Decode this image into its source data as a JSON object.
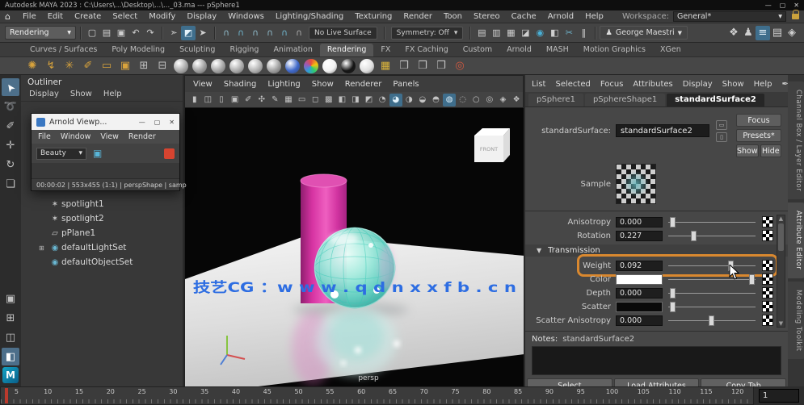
{
  "window": {
    "title": "Autodesk MAYA 2023 : C:\\Users\\...\\Desktop\\...\\..._03.ma  ---  pSphere1",
    "controls": {
      "min": "—",
      "max": "▢",
      "close": "✕"
    }
  },
  "menubar": {
    "home_icon": "⌂",
    "items": [
      "File",
      "Edit",
      "Create",
      "Select",
      "Modify",
      "Display",
      "Windows",
      "Lighting/Shading",
      "Texturing",
      "Render",
      "Toon",
      "Stereo",
      "Cache",
      "Arnold",
      "Help"
    ],
    "workspace_label": "Workspace:",
    "workspace_value": "General*"
  },
  "statusline": {
    "menuset": "Rendering",
    "file_tools": [
      {
        "name": "new-scene-icon",
        "glyph": "▢"
      },
      {
        "name": "open-scene-icon",
        "glyph": "▤"
      },
      {
        "name": "save-scene-icon",
        "glyph": "▣"
      },
      {
        "name": "undo-icon",
        "glyph": "↶"
      },
      {
        "name": "redo-icon",
        "glyph": "↷"
      }
    ],
    "selection_tools": [
      {
        "name": "select-hierarchy-icon",
        "glyph": "➣"
      },
      {
        "name": "select-object-icon",
        "glyph": "◩",
        "active": true
      },
      {
        "name": "select-component-icon",
        "glyph": "➤"
      }
    ],
    "snap_tools": [
      {
        "name": "snap-grid-icon",
        "glyph": "∩",
        "color": "#8fb9c9"
      },
      {
        "name": "snap-curve-icon",
        "glyph": "∩",
        "color": "#6fb4cc"
      },
      {
        "name": "snap-point-icon",
        "glyph": "∩",
        "color": "#8fb9c9"
      },
      {
        "name": "snap-projected-icon",
        "glyph": "∩",
        "color": "#8fb9c9"
      },
      {
        "name": "snap-view-icon",
        "glyph": "∩",
        "color": "#6fb4cc"
      },
      {
        "name": "snap-surface-icon",
        "glyph": "∩",
        "color": "#a9a9a9"
      }
    ],
    "live_surface_label": "No Live Surface",
    "symmetry_label": "Symmetry: Off",
    "render_tools": [
      {
        "name": "render-frame-icon",
        "glyph": "▤"
      },
      {
        "name": "ipr-render-icon",
        "glyph": "▥"
      },
      {
        "name": "render-sequence-icon",
        "glyph": "▦"
      },
      {
        "name": "render-settings-icon",
        "glyph": "◪"
      },
      {
        "name": "arnold-renderview-icon",
        "glyph": "◉",
        "color": "#49b0d6"
      },
      {
        "name": "texture-view-icon",
        "glyph": "◧"
      },
      {
        "name": "cut-icon",
        "glyph": "✂",
        "color": "#6fb4cc"
      },
      {
        "name": "pause-icon",
        "glyph": "‖"
      }
    ],
    "user": {
      "icon": "♟",
      "label": "George Maestri",
      "caret": "▼"
    },
    "panel_toggles": [
      {
        "name": "modeling-toolkit-icon",
        "glyph": "❖"
      },
      {
        "name": "character-controls-icon",
        "glyph": "♟"
      },
      {
        "name": "channel-box-icon",
        "glyph": "≡",
        "active": true
      },
      {
        "name": "attribute-editor-icon",
        "glyph": "▤"
      },
      {
        "name": "tool-settings-icon",
        "glyph": "◈"
      }
    ]
  },
  "shelf": {
    "corner_icon": "☰",
    "tabs": [
      {
        "label": "Curves / Surfaces"
      },
      {
        "label": "Poly Modeling"
      },
      {
        "label": "Sculpting"
      },
      {
        "label": "Rigging"
      },
      {
        "label": "Animation"
      },
      {
        "label": "Rendering",
        "active": true
      },
      {
        "label": "FX"
      },
      {
        "label": "FX Caching"
      },
      {
        "label": "Custom"
      },
      {
        "label": "Arnold"
      },
      {
        "label": "MASH"
      },
      {
        "label": "Motion Graphics"
      },
      {
        "label": "XGen"
      }
    ],
    "icons": [
      {
        "name": "area-light-icon",
        "glyph": "✺",
        "color": "#d8a33c"
      },
      {
        "name": "directional-light-icon",
        "glyph": "↯",
        "color": "#d8a33c"
      },
      {
        "name": "point-light-icon",
        "glyph": "✳",
        "color": "#d8a33c"
      },
      {
        "name": "spot-light-icon",
        "glyph": "✐",
        "color": "#d8a33c"
      },
      {
        "name": "volume-light-icon",
        "glyph": "▭",
        "color": "#d8a33c"
      },
      {
        "name": "ambient-light-icon",
        "glyph": "▣",
        "color": "#d8a33c"
      },
      {
        "name": "shading-group-icon",
        "glyph": "⊞",
        "color": "#c2c2c2"
      },
      {
        "name": "hypershade-icon",
        "glyph": "⊟",
        "color": "#c2c2c2"
      },
      {
        "name": "lambert-material-icon",
        "shape": "ball",
        "color": "#a9a9a9"
      },
      {
        "name": "blinn-material-icon",
        "shape": "ball",
        "color": "#9f9f9f"
      },
      {
        "name": "phong-material-icon",
        "shape": "ball",
        "color": "#a5a5a5"
      },
      {
        "name": "standard-surface-icon",
        "shape": "ball",
        "color": "#ababab"
      },
      {
        "name": "ai-standard-surface-icon",
        "shape": "ball",
        "color": "#b2b2b2"
      },
      {
        "name": "layered-shader-icon",
        "shape": "ball",
        "color": "#a0a0a0"
      },
      {
        "name": "car-paint-shader-icon",
        "shape": "ball",
        "color": "#3f68c9"
      },
      {
        "name": "toon-shader-icon",
        "shape": "ball",
        "color": "rainbow"
      },
      {
        "name": "surface-shader-white-icon",
        "shape": "ball",
        "color": "#f2f2f2"
      },
      {
        "name": "surface-shader-black-icon",
        "shape": "ball",
        "color": "#141414"
      },
      {
        "name": "use-background-icon",
        "shape": "ball",
        "color": "#e0e0e0"
      },
      {
        "name": "checker-texture-icon",
        "glyph": "▦",
        "color": "#d8b23c"
      },
      {
        "name": "assign-material-icon",
        "glyph": "❒",
        "color": "#c2c2c2"
      },
      {
        "name": "bake-texture-icon",
        "glyph": "❒",
        "color": "#c2c2c2"
      },
      {
        "name": "light-editor-icon",
        "glyph": "❒",
        "color": "#c2c2c2"
      },
      {
        "name": "render-target-icon",
        "glyph": "◎",
        "color": "#cf5840"
      }
    ]
  },
  "toolbox": {
    "tools": [
      {
        "name": "select-tool",
        "glyph": "➤",
        "active": true
      },
      {
        "name": "lasso-tool",
        "glyph": "➰"
      },
      {
        "name": "paint-select-tool",
        "glyph": "✐"
      },
      {
        "name": "move-tool",
        "glyph": "✛"
      },
      {
        "name": "rotate-tool",
        "glyph": "↻"
      },
      {
        "name": "scale-tool",
        "glyph": "❏"
      }
    ],
    "layouts": [
      {
        "name": "layout-single-pane",
        "glyph": "▣"
      },
      {
        "name": "layout-four-pane",
        "glyph": "⊞"
      },
      {
        "name": "layout-two-pane",
        "glyph": "◫"
      },
      {
        "name": "layout-outliner-persp",
        "glyph": "◧",
        "active": true
      }
    ],
    "maya_logo": "M"
  },
  "outliner": {
    "title": "Outliner",
    "menus": [
      "Display",
      "Show",
      "Help"
    ],
    "items": [
      {
        "label": "spotlight1",
        "icon": "✶",
        "icon_color": "#cccccc"
      },
      {
        "label": "spotlight2",
        "icon": "✶",
        "icon_color": "#cccccc"
      },
      {
        "label": "pPlane1",
        "icon": "▱",
        "icon_color": "#cccccc"
      },
      {
        "label": "defaultLightSet",
        "icon": "◉",
        "icon_color": "#69b7d2",
        "expand": true
      },
      {
        "label": "defaultObjectSet",
        "icon": "◉",
        "icon_color": "#69b7d2"
      }
    ]
  },
  "arnold_window": {
    "title": "Arnold Viewp...",
    "controls": {
      "min": "—",
      "max": "▢",
      "close": "✕"
    },
    "menus": [
      "File",
      "Window",
      "View",
      "Render"
    ],
    "aov_value": "Beauty",
    "status": "00:00:02 | 553x455 (1:1) | perspShape | samp"
  },
  "viewport": {
    "menus": [
      "View",
      "Shading",
      "Lighting",
      "Show",
      "Renderer",
      "Panels"
    ],
    "icons": [
      {
        "name": "camera-icon",
        "glyph": "▮"
      },
      {
        "name": "camera-settings-icon",
        "glyph": "◫"
      },
      {
        "name": "bookmark-icon",
        "glyph": "▯"
      },
      {
        "name": "image-plane-icon",
        "glyph": "▣"
      },
      {
        "name": "2d-pan-zoom-icon",
        "glyph": "✐"
      },
      {
        "name": "joint-size-icon",
        "glyph": "✣"
      },
      {
        "name": "grease-pencil-icon",
        "glyph": "✎"
      },
      {
        "name": "grid-icon",
        "glyph": "▦"
      },
      {
        "name": "film-gate-icon",
        "glyph": "▭"
      },
      {
        "name": "resolution-gate-icon",
        "glyph": "◻"
      },
      {
        "name": "gate-mask-icon",
        "glyph": "▩"
      },
      {
        "name": "field-chart-icon",
        "glyph": "◧"
      },
      {
        "name": "safe-action-icon",
        "glyph": "◨"
      },
      {
        "name": "safe-title-icon",
        "glyph": "◩"
      },
      {
        "name": "wireframe-icon",
        "glyph": "◔"
      },
      {
        "name": "shaded-icon",
        "glyph": "◕",
        "active": true
      },
      {
        "name": "textured-icon",
        "glyph": "◑"
      },
      {
        "name": "use-all-lights-icon",
        "glyph": "◒"
      },
      {
        "name": "shadows-icon",
        "glyph": "◓"
      },
      {
        "name": "ambient-occlusion-icon",
        "glyph": "◍",
        "active": true
      },
      {
        "name": "motion-blur-icon",
        "glyph": "◌"
      },
      {
        "name": "xray-icon",
        "glyph": "○"
      },
      {
        "name": "isolate-select-icon",
        "glyph": "◎"
      },
      {
        "name": "fx-icon",
        "glyph": "◈"
      },
      {
        "name": "plugin-shapes-icon",
        "glyph": "❖"
      }
    ],
    "viewcube_label": "FRONT",
    "watermark": "技艺CG ：w w w . q d n x x f b . c n",
    "camera_label": "persp"
  },
  "attribute_editor": {
    "menus": [
      "List",
      "Selected",
      "Focus",
      "Attributes",
      "Display",
      "Show",
      "Help"
    ],
    "pin_icon": "✒",
    "tabs": [
      {
        "label": "pSphere1"
      },
      {
        "label": "pSphereShape1"
      },
      {
        "label": "standardSurface2",
        "active": true
      }
    ],
    "node_label": "standardSurface:",
    "node_value": "standardSurface2",
    "buttons": {
      "focus": "Focus",
      "presets": "Presets*",
      "show": "Show",
      "hide": "Hide"
    },
    "sample_label": "Sample",
    "specular_rows": [
      {
        "name": "anisotropy-attribute",
        "label": "Anisotropy",
        "value": "0.000",
        "slider": 0.06
      },
      {
        "name": "rotation-attribute",
        "label": "Rotation",
        "value": "0.227",
        "slider": 0.3
      }
    ],
    "transmission": {
      "header": "Transmission",
      "rows": [
        {
          "name": "weight-attribute",
          "label": "Weight",
          "value": "0.092",
          "slider": 0.72,
          "highlight": true
        },
        {
          "name": "color-attribute",
          "label": "Color",
          "swatch": "#ffffff",
          "slider": 0.96
        },
        {
          "name": "depth-attribute",
          "label": "Depth",
          "value": "0.000",
          "slider": 0.06
        },
        {
          "name": "scatter-attribute",
          "label": "Scatter",
          "swatch": "#0a0a0a",
          "slider": 0.06
        },
        {
          "name": "scatter-anisotropy-attribute",
          "label": "Scatter Anisotropy",
          "value": "0.000",
          "slider": 0.5
        }
      ]
    },
    "notes_label": "Notes:",
    "notes_value": "standardSurface2",
    "footer_buttons": [
      "Select",
      "Load Attributes",
      "Copy Tab"
    ]
  },
  "right_tabs": [
    {
      "label": "Channel Box / Layer Editor"
    },
    {
      "label": "Attribute Editor",
      "active": true
    },
    {
      "label": "Modeling Toolkit"
    }
  ],
  "timeline": {
    "ticks": [
      "5",
      "10",
      "15",
      "20",
      "25",
      "30",
      "35",
      "40",
      "45",
      "50",
      "55",
      "60",
      "65",
      "70",
      "75",
      "80",
      "85",
      "90",
      "95",
      "100",
      "105",
      "110",
      "115",
      "120"
    ],
    "current_frame": "1"
  }
}
